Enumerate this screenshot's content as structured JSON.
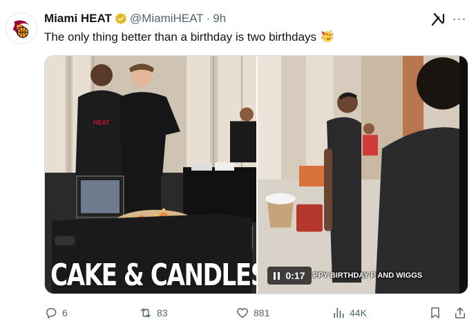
{
  "tweet": {
    "author_name": "Miami HEAT",
    "handle": "@MiamiHEAT",
    "separator": "·",
    "time": "9h",
    "text": "The only thing better than a birthday is two birthdays",
    "emoji": "party-face-emoji"
  },
  "header_icons": {
    "grok": "grok-icon",
    "more": "···"
  },
  "media": {
    "left_caption": "CAKE & CANDLES",
    "video_time": "0:17",
    "video_subtitle": "PPY BIRTHDAY P AND WIGGS"
  },
  "actions": {
    "replies": "6",
    "reposts": "83",
    "likes": "881",
    "views": "44K"
  },
  "colors": {
    "text_primary": "#0f1419",
    "text_secondary": "#536471",
    "verified_gold": "#e2b719",
    "heat_red": "#98002e",
    "border": "#cfd9de"
  }
}
